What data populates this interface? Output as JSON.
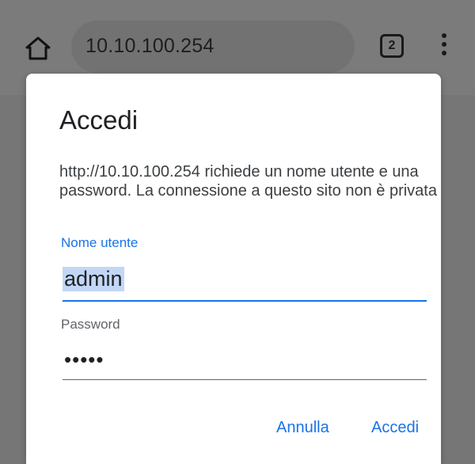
{
  "browser": {
    "url": "10.10.100.254",
    "tab_count": "2",
    "home_icon": "home-icon",
    "menu_icon": "more-vert-icon"
  },
  "dialog": {
    "title": "Accedi",
    "message": "http://10.10.100.254 richiede un nome utente e una password. La connessione a questo sito non è privata",
    "username": {
      "label": "Nome utente",
      "value": "admin"
    },
    "password": {
      "label": "Password",
      "value": "•••••"
    },
    "buttons": {
      "cancel": "Annulla",
      "login": "Accedi"
    }
  },
  "colors": {
    "accent": "#1a73e8",
    "scrim": "#767676",
    "selection": "#c2d7f5"
  }
}
